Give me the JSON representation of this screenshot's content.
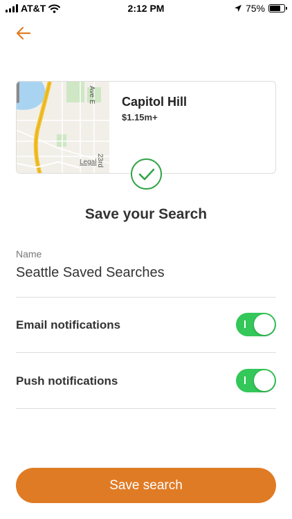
{
  "status_bar": {
    "carrier": "AT&T",
    "time": "2:12 PM",
    "battery_percent": "75%",
    "battery_level": 0.75,
    "icons": [
      "signal-icon",
      "wifi-icon",
      "location-arrow-icon",
      "battery-icon"
    ]
  },
  "header": {
    "back_icon": "arrow-left-icon"
  },
  "listing": {
    "title": "Capitol Hill",
    "price": "$1.15m+",
    "map": {
      "legal_label": "Legal",
      "street_labels": [
        "Ave E",
        "23rd"
      ]
    }
  },
  "success_icon": "checkmark-circle-icon",
  "heading": "Save your Search",
  "form": {
    "name_label": "Name",
    "name_value": "Seattle Saved Searches",
    "email_notifications_label": "Email notifications",
    "email_notifications_on": true,
    "push_notifications_label": "Push notifications",
    "push_notifications_on": true
  },
  "actions": {
    "save_label": "Save search"
  },
  "colors": {
    "accent": "#e07b25",
    "toggle_on": "#34c759",
    "success": "#2fa344"
  }
}
